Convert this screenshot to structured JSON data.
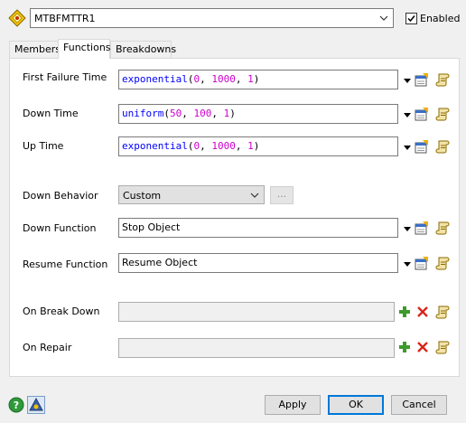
{
  "header": {
    "object_name": "MTBFMTTR1",
    "enabled_label": "Enabled",
    "enabled_checked": true
  },
  "tabs": [
    {
      "label": "Members"
    },
    {
      "label": "Functions",
      "active": true
    },
    {
      "label": "Breakdowns"
    }
  ],
  "rows": {
    "first_failure": {
      "label": "First Failure Time",
      "fn": "exponential",
      "args": [
        "0",
        "1000",
        "1"
      ]
    },
    "down_time": {
      "label": "Down Time",
      "fn": "uniform",
      "args": [
        "50",
        "100",
        "1"
      ]
    },
    "up_time": {
      "label": "Up Time",
      "fn": "exponential",
      "args": [
        "0",
        "1000",
        "1"
      ]
    },
    "down_behavior": {
      "label": "Down Behavior",
      "value": "Custom",
      "dots": "..."
    },
    "down_function": {
      "label": "Down Function",
      "value": "Stop Object"
    },
    "resume_function": {
      "label": "Resume Function",
      "value": "Resume Object"
    },
    "on_break_down": {
      "label": "On Break Down",
      "value": ""
    },
    "on_repair": {
      "label": "On Repair",
      "value": ""
    }
  },
  "footer": {
    "apply": "Apply",
    "ok": "OK",
    "cancel": "Cancel"
  },
  "icons": {
    "object": "diamond-object-icon",
    "help": "help-icon",
    "pin": "pin-icon",
    "properties": "properties-icon",
    "script": "script-icon",
    "add": "add-icon",
    "remove": "remove-icon"
  },
  "colors": {
    "function_name": "#0000ff",
    "number": "#cc00cc",
    "default_button": "#0078d7"
  }
}
